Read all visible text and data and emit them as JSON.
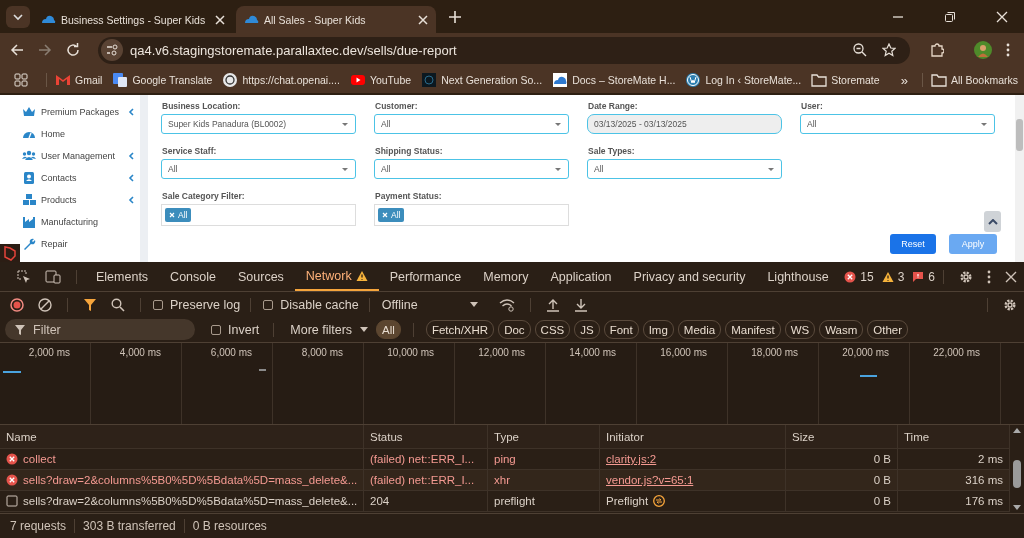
{
  "browser": {
    "tabs": [
      {
        "title": "Business Settings - Super Kids",
        "selected": false
      },
      {
        "title": "All Sales - Super Kids",
        "selected": true
      }
    ],
    "url": "qa4.v6.stagingstoremate.parallaxtec.dev/sells/due-report",
    "bookmarks": [
      {
        "label": "Gmail",
        "kind": "gmail"
      },
      {
        "label": "Google Translate",
        "kind": "translate"
      },
      {
        "label": "https://chat.openai....",
        "kind": "globe"
      },
      {
        "label": "YouTube",
        "kind": "youtube"
      },
      {
        "label": "Next Generation So...",
        "kind": "dark"
      },
      {
        "label": "Docs – StoreMate H...",
        "kind": "cloud"
      },
      {
        "label": "Log In ‹ StoreMate...",
        "kind": "wordpress"
      },
      {
        "label": "Storemate",
        "kind": "folder"
      }
    ],
    "overflow": "»",
    "all_bookmarks": "All Bookmarks"
  },
  "sidebar": {
    "items": [
      {
        "label": "Premium Packages",
        "kind": "crown",
        "has_submenu": true
      },
      {
        "label": "Home",
        "kind": "dashboard",
        "has_submenu": false
      },
      {
        "label": "User Management",
        "kind": "users",
        "has_submenu": true
      },
      {
        "label": "Contacts",
        "kind": "contact",
        "has_submenu": true
      },
      {
        "label": "Products",
        "kind": "cubes",
        "has_submenu": true
      },
      {
        "label": "Manufacturing",
        "kind": "factory",
        "has_submenu": false
      },
      {
        "label": "Repair",
        "kind": "wrench",
        "has_submenu": false
      }
    ]
  },
  "filters": {
    "rows": [
      [
        {
          "label": "Business Location:",
          "kind": "select",
          "value": "Super Kids Panadura (BL0002)"
        },
        {
          "label": "Customer:",
          "kind": "select",
          "value": "All"
        },
        {
          "label": "Date Range:",
          "kind": "date",
          "value": "03/13/2025 - 03/13/2025"
        },
        {
          "label": "User:",
          "kind": "select",
          "value": "All"
        }
      ],
      [
        {
          "label": "Service Staff:",
          "kind": "select",
          "value": "All"
        },
        {
          "label": "Shipping Status:",
          "kind": "select",
          "value": "All"
        },
        {
          "label": "Sale Types:",
          "kind": "select",
          "value": "All"
        }
      ],
      [
        {
          "label": "Sale Category Filter:",
          "kind": "tags",
          "tags": [
            "All"
          ]
        },
        {
          "label": "Payment Status:",
          "kind": "tags",
          "tags": [
            "All"
          ]
        }
      ]
    ],
    "buttons": [
      {
        "label": "Reset",
        "disabled": false
      },
      {
        "label": "Apply",
        "disabled": true
      }
    ]
  },
  "devtools": {
    "tabs": [
      {
        "label": "Elements",
        "selected": false,
        "warning": false
      },
      {
        "label": "Console",
        "selected": false,
        "warning": false
      },
      {
        "label": "Sources",
        "selected": false,
        "warning": false
      },
      {
        "label": "Network",
        "selected": true,
        "warning": true
      },
      {
        "label": "Performance",
        "selected": false,
        "warning": false
      },
      {
        "label": "Memory",
        "selected": false,
        "warning": false
      },
      {
        "label": "Application",
        "selected": false,
        "warning": false
      },
      {
        "label": "Privacy and security",
        "selected": false,
        "warning": false
      },
      {
        "label": "Lighthouse",
        "selected": false,
        "warning": false
      }
    ],
    "counts": [
      {
        "kind": "error",
        "value": "15"
      },
      {
        "kind": "warning",
        "value": "3"
      },
      {
        "kind": "issue",
        "value": "6"
      }
    ],
    "checkboxes": [
      {
        "label": "Preserve log",
        "checked": false
      },
      {
        "label": "Disable cache",
        "checked": false
      }
    ],
    "throttling": "Offline",
    "filter": {
      "placeholder": "Filter",
      "invert": {
        "label": "Invert",
        "checked": false
      },
      "more_filters": "More filters",
      "types": [
        {
          "label": "All",
          "selected": true
        },
        {
          "label": "Fetch/XHR",
          "selected": false
        },
        {
          "label": "Doc",
          "selected": false
        },
        {
          "label": "CSS",
          "selected": false
        },
        {
          "label": "JS",
          "selected": false
        },
        {
          "label": "Font",
          "selected": false
        },
        {
          "label": "Img",
          "selected": false
        },
        {
          "label": "Media",
          "selected": false
        },
        {
          "label": "Manifest",
          "selected": false
        },
        {
          "label": "WS",
          "selected": false
        },
        {
          "label": "Wasm",
          "selected": false
        },
        {
          "label": "Other",
          "selected": false
        }
      ]
    },
    "timeline": {
      "ticks": [
        "2,000 ms",
        "4,000 ms",
        "6,000 ms",
        "8,000 ms",
        "10,000 ms",
        "12,000 ms",
        "14,000 ms",
        "16,000 ms",
        "18,000 ms",
        "20,000 ms",
        "22,000 ms"
      ]
    },
    "table": {
      "columns": [
        "Name",
        "Status",
        "Type",
        "Initiator",
        "Size",
        "Time"
      ],
      "rows": [
        {
          "kind": "failed",
          "name": "collect",
          "status": "(failed) net::ERR_I...",
          "type": "ping",
          "initiator": "clarity.js:2",
          "initiator_link": true,
          "initiator_icon": false,
          "size": "0 B",
          "time": "2 ms"
        },
        {
          "kind": "failed",
          "name": "sells?draw=2&columns%5B0%5D%5Bdata%5D=mass_delete&...",
          "status": "(failed) net::ERR_I...",
          "type": "xhr",
          "initiator": "vendor.js?v=65:1",
          "initiator_link": true,
          "initiator_icon": false,
          "size": "0 B",
          "time": "316 ms"
        },
        {
          "kind": "ok",
          "name": "sells?draw=2&columns%5B0%5D%5Bdata%5D=mass_delete&...",
          "status": "204",
          "type": "preflight",
          "initiator": "Preflight",
          "initiator_link": false,
          "initiator_icon": true,
          "size": "0 B",
          "time": "176 ms"
        }
      ]
    },
    "status_bar": [
      "7 requests",
      "303 B transferred",
      "0 B resources"
    ]
  }
}
